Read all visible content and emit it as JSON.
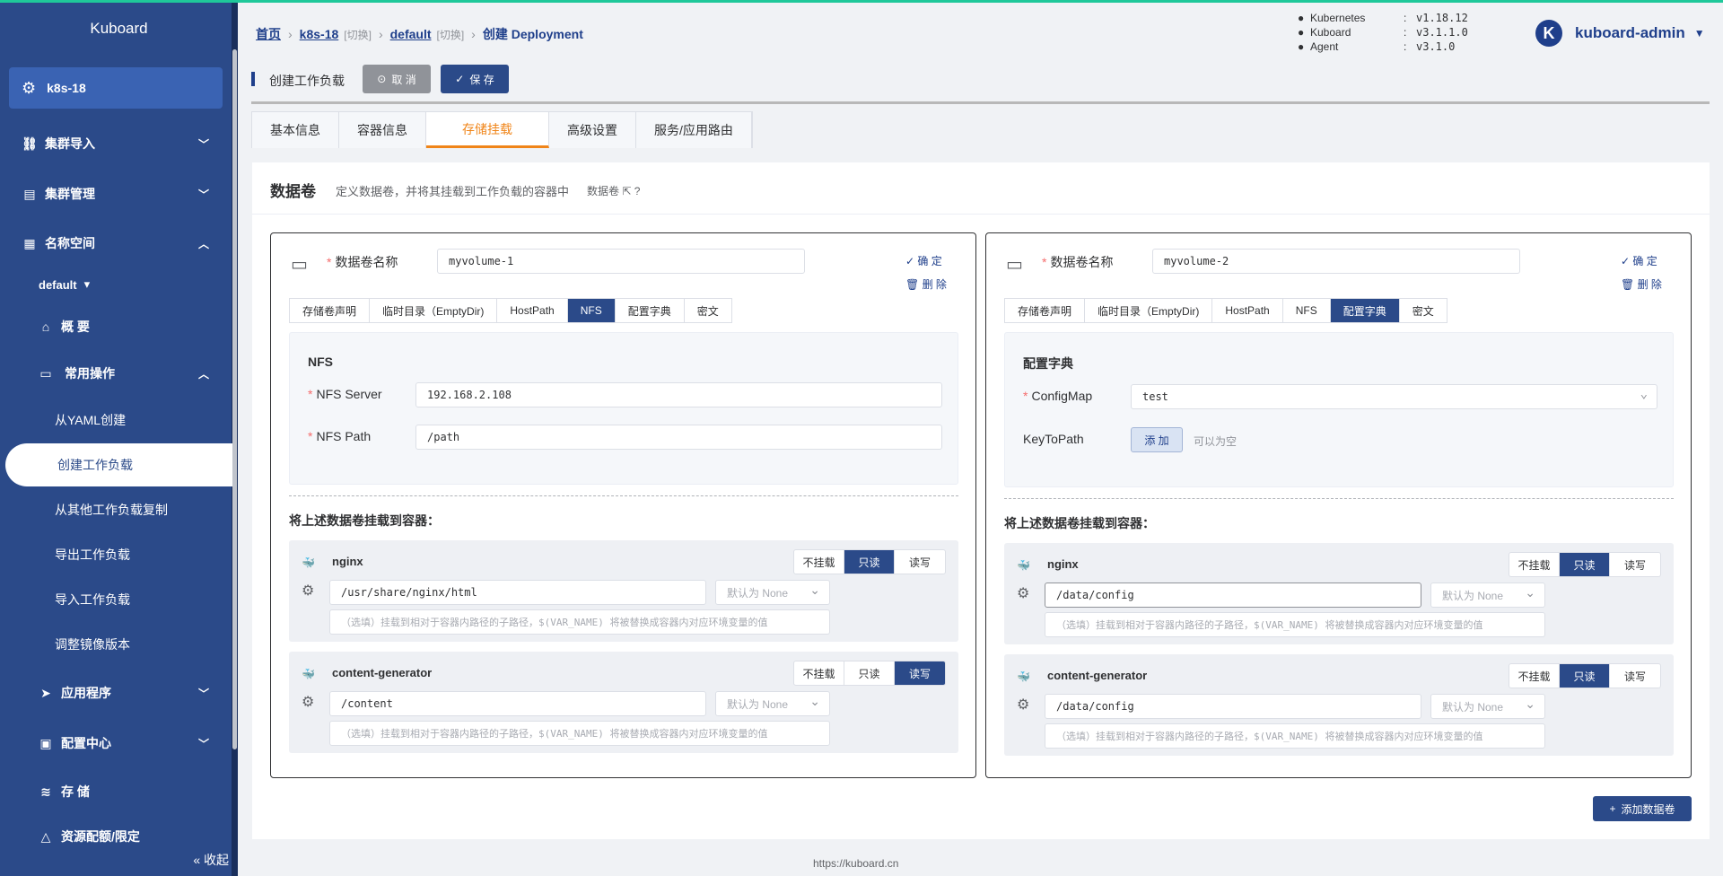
{
  "app": {
    "brand": "Kuboard",
    "footer": "https://kuboard.cn"
  },
  "sidebar": {
    "cluster": "k8s-18",
    "items": [
      {
        "label": "集群导入",
        "icon": "link-icon"
      },
      {
        "label": "集群管理",
        "icon": "server-icon"
      },
      {
        "label": "名称空间",
        "icon": "grid-icon"
      }
    ],
    "namespace": "default",
    "ns_items": [
      {
        "label": "概 要"
      },
      {
        "label": "常用操作"
      }
    ],
    "ops": [
      "从YAML创建",
      "创建工作负载",
      "从其他工作负载复制",
      "导出工作负载",
      "导入工作负载",
      "调整镜像版本"
    ],
    "bottom": [
      {
        "label": "应用程序"
      },
      {
        "label": "配置中心"
      },
      {
        "label": "存 储"
      },
      {
        "label": "资源配额/限定"
      }
    ],
    "collapse": "收起"
  },
  "breadcrumb": {
    "home": "首页",
    "cluster": "k8s-18",
    "switch1": "[切换]",
    "namespace": "default",
    "switch2": "[切换]",
    "current": "创建 Deployment"
  },
  "versions": [
    {
      "k": "Kubernetes",
      "v": "v1.18.12"
    },
    {
      "k": "Kuboard",
      "v": "v3.1.1.0"
    },
    {
      "k": "Agent",
      "v": "v3.1.0"
    }
  ],
  "user": {
    "avatar": "K",
    "name": "kuboard-admin"
  },
  "action": {
    "title": "创建工作负载",
    "cancel": "取 消",
    "save": "保 存"
  },
  "tabs": [
    "基本信息",
    "容器信息",
    "存储挂载",
    "高级设置",
    "服务/应用路由"
  ],
  "panel": {
    "title": "数据卷",
    "desc": "定义数据卷，并将其挂载到工作负载的容器中",
    "link": "数据卷"
  },
  "volume_tabs": [
    "存储卷声明",
    "临时目录（EmptyDir)",
    "HostPath",
    "NFS",
    "配置字典",
    "密文"
  ],
  "common": {
    "name_label": "数据卷名称",
    "confirm": "确 定",
    "delete": "删 除",
    "mount_title": "将上述数据卷挂载到容器：",
    "modes": [
      "不挂载",
      "只读",
      "读写"
    ],
    "subpath_ph": "（选填）挂载到相对于容器内路径的子路径，$(VAR_NAME) 将被替换成容器内对应环境变量的值",
    "default_none": "默认为 None"
  },
  "volume1": {
    "name": "myvolume-1",
    "section": "NFS",
    "server_label": "NFS Server",
    "server": "192.168.2.108",
    "path_label": "NFS Path",
    "path": "/path",
    "mounts": [
      {
        "container": "nginx",
        "path": "/usr/share/nginx/html",
        "mode": "只读"
      },
      {
        "container": "content-generator",
        "path": "/content",
        "mode": "读写"
      }
    ]
  },
  "volume2": {
    "name": "myvolume-2",
    "section": "配置字典",
    "cm_label": "ConfigMap",
    "cm": "test",
    "ktp_label": "KeyToPath",
    "add": "添 加",
    "optional": "可以为空",
    "mounts": [
      {
        "container": "nginx",
        "path": "/data/config",
        "mode": "只读"
      },
      {
        "container": "content-generator",
        "path": "/data/config",
        "mode": "只读"
      }
    ]
  },
  "add_volume": "添加数据卷"
}
